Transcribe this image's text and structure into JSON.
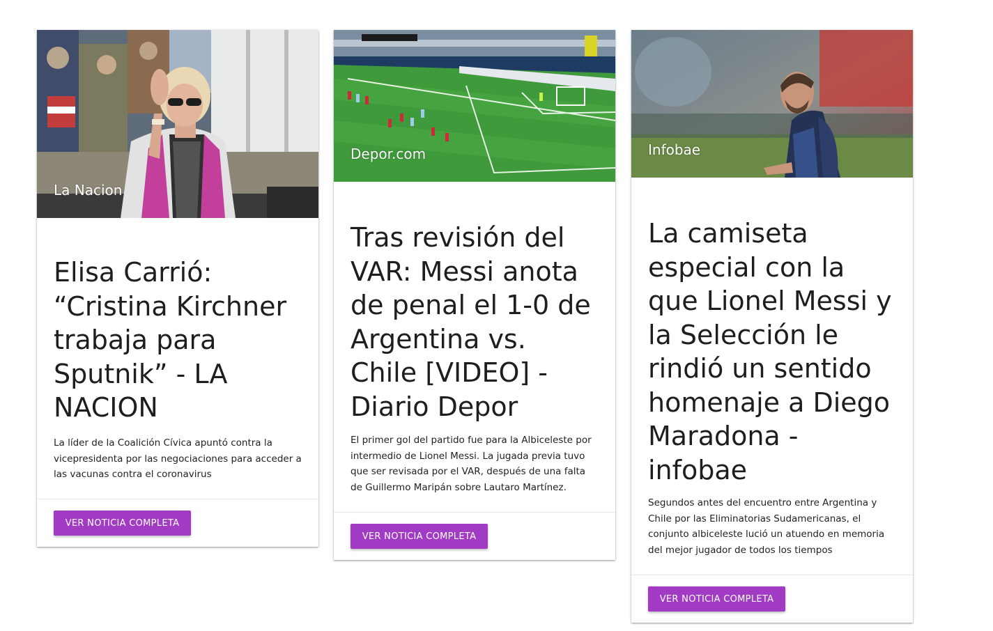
{
  "colors": {
    "button_bg": "#a13bc4",
    "button_text": "#ffffff",
    "title_text": "#1e1e1e"
  },
  "cards": [
    {
      "source": "La Nacion",
      "image_description_icon": "photo-woman-waving-icon",
      "title": "Elisa Carrió: “Cristina Kirchner trabaja para Sputnik” - LA NACION",
      "description": "La líder de la Coalición Cívica apuntó contra la vicepresidenta por las negociaciones para acceder a las vacunas contra el coronavirus",
      "button_label": "VER NOTICIA COMPLETA"
    },
    {
      "source": "Depor.com",
      "image_description_icon": "photo-football-pitch-icon",
      "title": "Tras revisión del VAR: Messi anota de penal el 1-0 de Argentina vs. Chile [VIDEO] - Diario Depor",
      "description": "El primer gol del partido fue para la Albiceleste por intermedio de Lionel Messi. La jugada previa tuvo que ser revisada por el VAR, después de una falta de Guillermo Maripán sobre Lautaro Martínez.",
      "button_label": "VER NOTICIA COMPLETA"
    },
    {
      "source": "Infobae",
      "image_description_icon": "photo-player-icon",
      "title": "La camiseta especial con la que Lionel Messi y la Selección le rindió un sentido homenaje a Diego Maradona - infobae",
      "description": "Segundos antes del encuentro entre Argentina y Chile por las Eliminatorias Sudamericanas, el conjunto albiceleste lució un atuendo en memoria del mejor jugador de todos los tiempos",
      "button_label": "VER NOTICIA COMPLETA"
    }
  ]
}
